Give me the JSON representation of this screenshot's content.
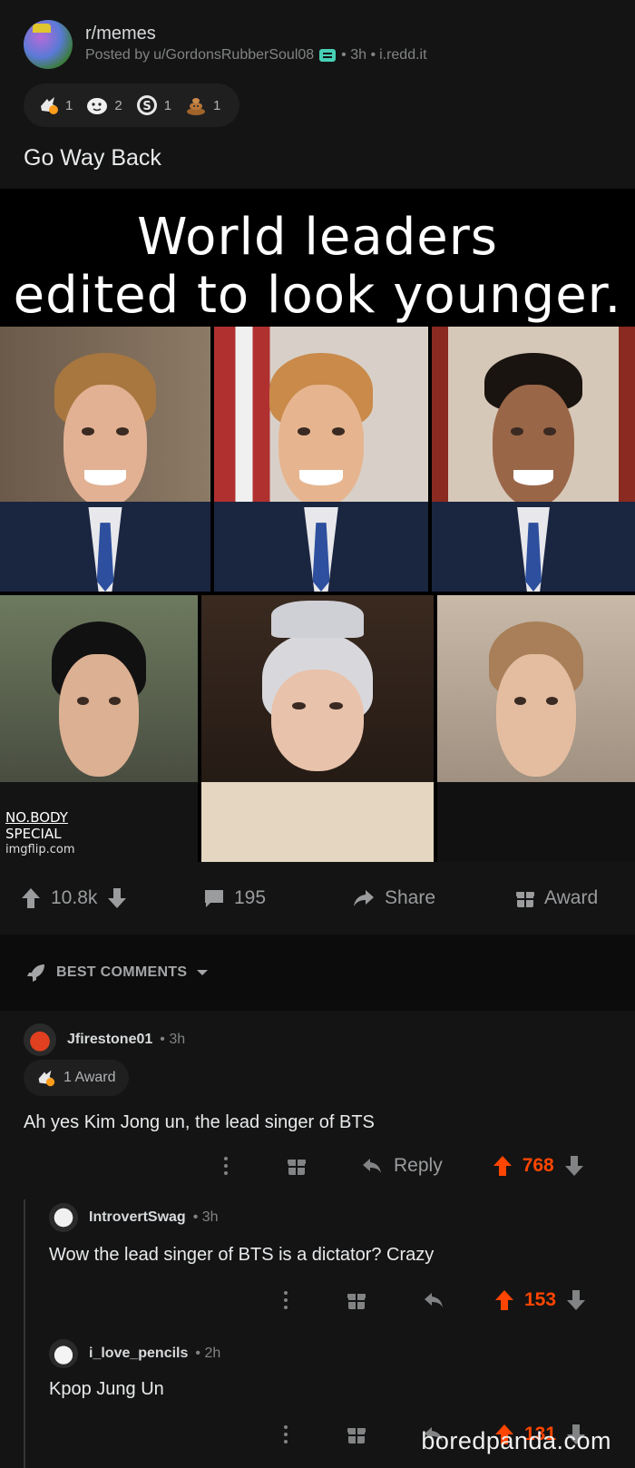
{
  "post": {
    "subreddit": "r/memes",
    "posted_prefix": "Posted by",
    "author": "u/GordonsRubberSoul08",
    "time": "• 3h •",
    "domain": "i.redd.it",
    "title": "Go Way Back",
    "awards": [
      {
        "icon": "wholesome-award-icon",
        "count": "1"
      },
      {
        "icon": "hugz-award-icon",
        "count": "2"
      },
      {
        "icon": "silver-coin-icon",
        "count": "1"
      },
      {
        "icon": "poop-award-icon",
        "count": "1"
      }
    ]
  },
  "meme": {
    "caption_line1": "World leaders",
    "caption_line2": "edited to look younger.",
    "watermark_line1": "NO.BODY",
    "watermark_line2": "SPECIAL",
    "watermark_line3": "imgflip.com"
  },
  "actions": {
    "score": "10.8k",
    "comments": "195",
    "share": "Share",
    "award": "Award"
  },
  "sort": {
    "label": "BEST COMMENTS"
  },
  "comments": [
    {
      "user": "Jfirestone01",
      "time": "• 3h",
      "award_label": "1 Award",
      "body": "Ah yes Kim Jong un, the lead singer of BTS",
      "reply": "Reply",
      "score": "768"
    },
    {
      "user": "IntrovertSwag",
      "time": "• 3h",
      "body": "Wow the lead singer of BTS is a dictator?  Crazy",
      "score": "153"
    },
    {
      "user": "i_love_pencils",
      "time": "• 2h",
      "body": "Kpop Jung Un",
      "score": "131"
    }
  ],
  "watermark": "boredpanda.com",
  "colors": {
    "background": "#141414",
    "upvote_orange": "#ff4500",
    "mod_teal": "#46d160",
    "muted_text": "#818384"
  }
}
